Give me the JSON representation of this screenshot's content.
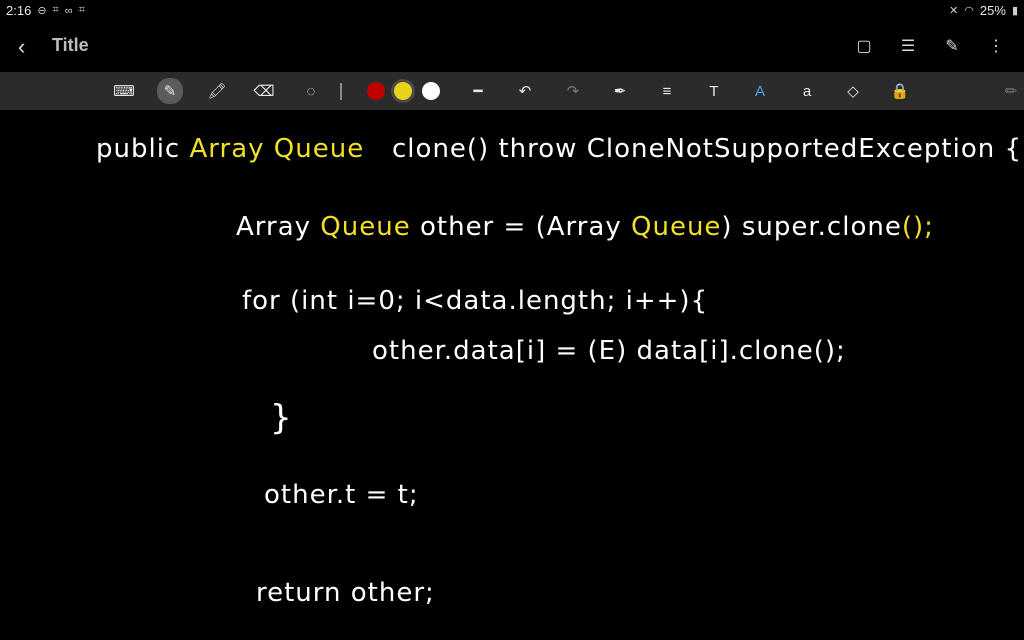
{
  "status": {
    "time": "2:16",
    "left_icons": [
      "minus-circle-icon",
      "screen-icon",
      "link-icon",
      "screen-icon"
    ],
    "battery": "25%",
    "right_icons": [
      "mute-icon",
      "wifi-icon",
      "battery-icon"
    ]
  },
  "appbar": {
    "title": "Title",
    "icons": [
      "book-icon",
      "list-icon",
      "attach-icon",
      "more-vert-icon"
    ]
  },
  "toolbar": {
    "tools": [
      "keyboard-icon",
      "pen-icon",
      "highlighter-icon",
      "eraser-icon",
      "lasso-icon"
    ],
    "colors": [
      "#c00000",
      "#e8d21a",
      "#ffffff"
    ],
    "selected_color": "#e8d21a",
    "tools2": [
      "stroke-width-icon",
      "undo-icon",
      "redo-icon",
      "pen-settings-icon",
      "text-align-icon",
      "text-icon",
      "font-icon",
      "text-box-icon",
      "shapes-icon",
      "lock-icon",
      "edit-icon"
    ]
  },
  "ink": {
    "line1_pre": "public ",
    "line1_y": "Array Queue",
    "line1_post": "   clone() throw CloneNotSupportedException {",
    "line2_pre": "Array ",
    "line2_y": "Queue",
    "line2_mid": " other = (Array ",
    "line2_y2": "Queue",
    "line2_post": ") super.clone",
    "line2_y3": "();",
    "line3": "for (int i=0; i<data.length; i++){",
    "line4": "other.data[i] = (E) data[i].clone();",
    "line5": "}",
    "line6": "other.t = t;",
    "line7": "return other;"
  }
}
